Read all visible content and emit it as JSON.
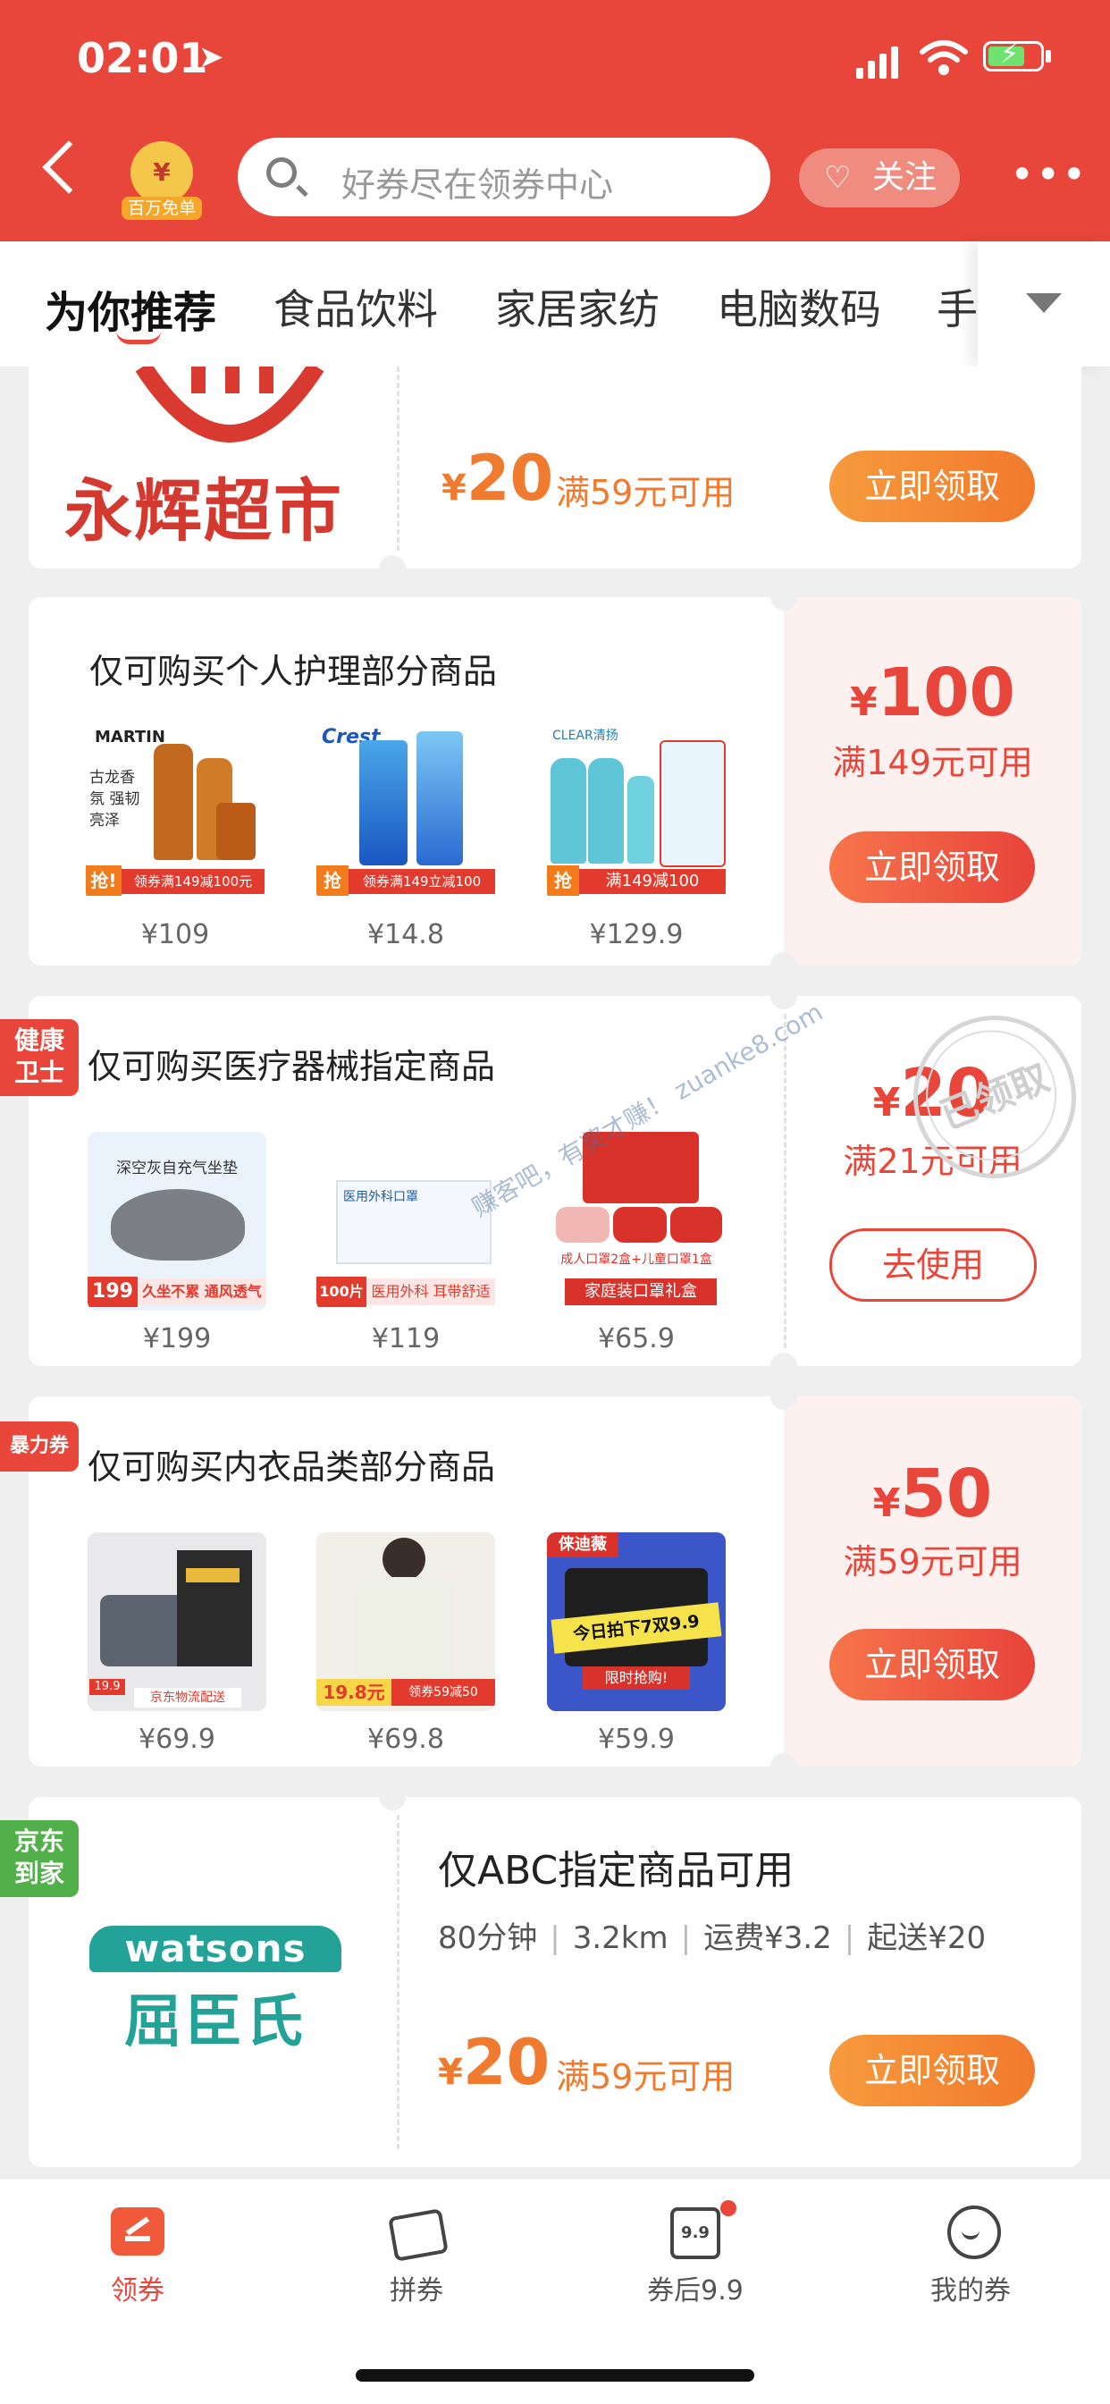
{
  "status_bar": {
    "time": "02:01"
  },
  "header": {
    "badge_label": "百万免单",
    "badge_coin": "¥",
    "search_placeholder": "好券尽在领券中心",
    "follow_label": "关注",
    "more_label": "•••"
  },
  "tabs": [
    "为你推荐",
    "食品饮料",
    "家居家纺",
    "电脑数码",
    "手"
  ],
  "cards": [
    {
      "store": "永辉超市",
      "amount_yen": "¥",
      "amount": "20",
      "condition": "满59元可用",
      "button": "立即领取"
    },
    {
      "title": "仅可购买个人护理部分商品",
      "products": [
        {
          "price": "¥109",
          "brand": "MARTIN",
          "text": "古龙香氛 强韧亮泽",
          "ribbon": "领券满149减100元",
          "tag": "抢!"
        },
        {
          "price": "¥14.8",
          "brand": "Crest",
          "text": "",
          "ribbon": "领券满149立减100",
          "tag": "抢"
        },
        {
          "price": "¥129.9",
          "brand": "CLEAR清扬",
          "text": "",
          "ribbon": "满149减100",
          "tag": "抢"
        }
      ],
      "amount_yen": "¥",
      "amount": "100",
      "condition": "满149元可用",
      "button": "立即领取"
    },
    {
      "side_tag": "健康\n卫士",
      "title": "仅可购买医疗器械指定商品",
      "products": [
        {
          "price": "¥199",
          "text": "深空灰自充气坐垫",
          "ribbon": "久坐不累 通风透气",
          "tag": "199"
        },
        {
          "price": "¥119",
          "text": "医用外科口罩",
          "ribbon": "医用外科 耳带舒适",
          "tag": "100片"
        },
        {
          "price": "¥65.9",
          "text": "成人口罩2盒+儿童口罩1盒",
          "ribbon": "家庭装口罩礼盒",
          "tag": ""
        }
      ],
      "amount_yen": "¥",
      "amount": "20",
      "condition": "满21元可用",
      "button": "去使用",
      "stamp": "已领取",
      "watermark": "赚客吧，有奖才赚！ zuanke8.com"
    },
    {
      "side_tag": "暴力券",
      "title": "仅可购买内衣品类部分商品",
      "products": [
        {
          "price": "¥69.9",
          "text": "",
          "ribbon": "京东物流配送",
          "tag": "19.9"
        },
        {
          "price": "¥69.8",
          "text": "",
          "ribbon": "领券59减50",
          "tag": "19.8元"
        },
        {
          "price": "¥59.9",
          "text": "今日拍下7双9.9",
          "ribbon": "限时抢购!",
          "tag": "俫迪薇"
        }
      ],
      "amount_yen": "¥",
      "amount": "50",
      "condition": "满59元可用",
      "button": "立即领取"
    },
    {
      "side_tag": "京东\n到家",
      "store_en": "watsons",
      "store_cn": "屈臣氏",
      "title": "仅ABC指定商品可用",
      "meta": [
        "80分钟",
        "3.2km",
        "运费¥3.2",
        "起送¥20"
      ],
      "amount_yen": "¥",
      "amount": "20",
      "condition": "满59元可用",
      "button": "立即领取"
    }
  ],
  "bottom_nav": [
    {
      "label": "领券",
      "active": true
    },
    {
      "label": "拼券",
      "active": false
    },
    {
      "label": "券后9.9",
      "active": false,
      "icon_text": "9.9"
    },
    {
      "label": "我的券",
      "active": false
    }
  ],
  "colors": {
    "brand": "#e8463a",
    "accent_orange": "#f7754b",
    "green": "#52b04a"
  }
}
